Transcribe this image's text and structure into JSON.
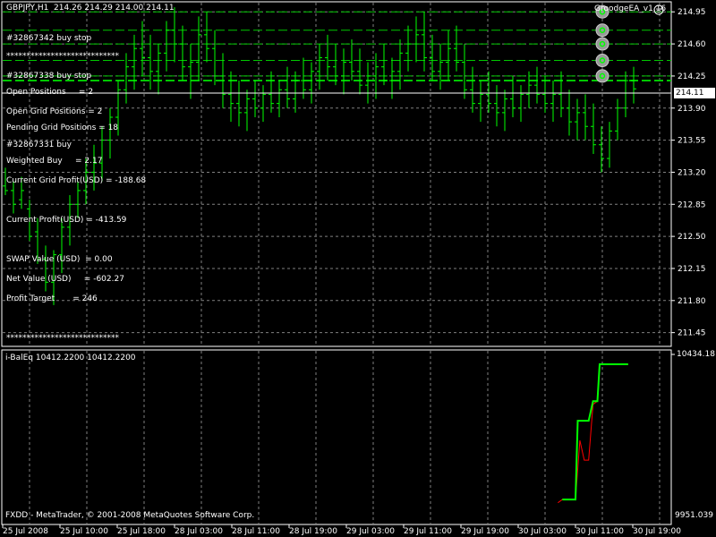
{
  "header": {
    "symbol_line": "GBPJPY,H1  214.26 214.29 214.00 214.11",
    "ea_name": "GroodgeEA_v1.16"
  },
  "info_panel": {
    "lines": [
      "#32867342 buy stop",
      "****************************",
      "#32867338 buy stop",
      "Open Positions     = 2",
      "Open Grid Positions = 2",
      "Pending Grid Positions = 18",
      "#32867331 buy",
      "Weighted Buy     = 2.17",
      "Current Grid Profit(USD) = -188.68",
      "",
      "Current Profit(USD) = -413.59",
      "",
      "SWAP Value (USD)  = 0.00",
      "Net Value (USD)     = -602.27",
      "Profit Target       = 246",
      "",
      "****************************"
    ]
  },
  "price_axis": {
    "labels": [
      "214.95",
      "214.60",
      "214.25",
      "213.90",
      "213.55",
      "213.20",
      "212.85",
      "212.50",
      "212.15",
      "211.80",
      "211.45"
    ],
    "current_price": "214.11"
  },
  "time_axis": {
    "labels": [
      "25 Jul 2008",
      "25 Jul 10:00",
      "25 Jul 18:00",
      "28 Jul 03:00",
      "28 Jul 11:00",
      "28 Jul 19:00",
      "29 Jul 03:00",
      "29 Jul 11:00",
      "29 Jul 19:00",
      "30 Jul 03:00",
      "30 Jul 11:00",
      "30 Jul 19:00"
    ]
  },
  "indicator": {
    "title": "i-BalEq 10412.2200 10412.2200",
    "axis_top": "10434.18",
    "axis_bottom": "9951.039"
  },
  "footer": {
    "copyright": "FXDD - MetaTrader, © 2001-2008 MetaQuotes Software Corp."
  },
  "colors": {
    "background": "#000000",
    "candle": "#00ff00",
    "grid": "#808080",
    "grid_levels": "#00c800",
    "balance_line": "#00ff00",
    "equity_line": "#ff0000"
  },
  "chart_data": {
    "type": "bar",
    "symbol": "GBPJPY",
    "timeframe": "H1",
    "ylim": [
      211.3,
      215.05
    ],
    "bars": [
      [
        213.05,
        213.25,
        212.95,
        213.0
      ],
      [
        213.0,
        213.1,
        212.75,
        212.85
      ],
      [
        212.9,
        213.15,
        212.8,
        213.0
      ],
      [
        212.8,
        212.9,
        212.45,
        212.5
      ],
      [
        212.55,
        212.7,
        212.2,
        212.25
      ],
      [
        212.25,
        212.4,
        211.9,
        212.0
      ],
      [
        212.0,
        212.35,
        211.75,
        212.3
      ],
      [
        212.3,
        212.7,
        212.1,
        212.6
      ],
      [
        212.6,
        212.95,
        212.4,
        212.85
      ],
      [
        212.85,
        213.1,
        212.7,
        213.0
      ],
      [
        213.0,
        213.35,
        212.85,
        213.2
      ],
      [
        213.2,
        213.5,
        213.0,
        213.3
      ],
      [
        213.3,
        213.7,
        213.1,
        213.55
      ],
      [
        213.55,
        213.9,
        213.35,
        213.8
      ],
      [
        213.8,
        214.2,
        213.6,
        214.1
      ],
      [
        214.1,
        214.5,
        213.95,
        214.35
      ],
      [
        214.35,
        214.7,
        214.1,
        214.55
      ],
      [
        214.55,
        214.85,
        214.25,
        214.45
      ],
      [
        214.45,
        214.7,
        214.1,
        214.3
      ],
      [
        214.3,
        214.6,
        214.05,
        214.5
      ],
      [
        214.5,
        214.85,
        214.3,
        214.75
      ],
      [
        214.75,
        215.0,
        214.4,
        214.6
      ],
      [
        214.6,
        214.8,
        214.2,
        214.35
      ],
      [
        214.35,
        214.6,
        214.0,
        214.4
      ],
      [
        214.4,
        214.9,
        214.2,
        214.7
      ],
      [
        214.7,
        214.95,
        214.4,
        214.55
      ],
      [
        214.55,
        214.75,
        214.15,
        214.25
      ],
      [
        214.25,
        214.5,
        213.9,
        214.05
      ],
      [
        214.05,
        214.3,
        213.75,
        213.95
      ],
      [
        213.95,
        214.2,
        213.7,
        213.85
      ],
      [
        213.85,
        214.1,
        213.65,
        214.0
      ],
      [
        214.0,
        214.2,
        213.8,
        213.9
      ],
      [
        213.9,
        214.15,
        213.75,
        214.05
      ],
      [
        214.05,
        214.3,
        213.85,
        213.95
      ],
      [
        213.95,
        214.2,
        213.8,
        214.1
      ],
      [
        214.1,
        214.35,
        213.9,
        214.0
      ],
      [
        214.0,
        214.3,
        213.85,
        214.2
      ],
      [
        214.2,
        214.45,
        214.0,
        214.1
      ],
      [
        214.1,
        214.4,
        213.95,
        214.3
      ],
      [
        214.3,
        214.6,
        214.1,
        214.45
      ],
      [
        214.45,
        214.7,
        214.2,
        214.35
      ],
      [
        214.35,
        214.6,
        214.15,
        214.25
      ],
      [
        214.25,
        214.55,
        214.05,
        214.4
      ],
      [
        214.4,
        214.65,
        214.2,
        214.3
      ],
      [
        214.3,
        214.55,
        214.05,
        214.15
      ],
      [
        214.15,
        214.4,
        213.95,
        214.25
      ],
      [
        214.25,
        214.5,
        214.0,
        214.35
      ],
      [
        214.35,
        214.6,
        214.15,
        214.2
      ],
      [
        214.2,
        214.45,
        214.0,
        214.3
      ],
      [
        214.3,
        214.65,
        214.1,
        214.5
      ],
      [
        214.5,
        214.8,
        214.3,
        214.6
      ],
      [
        214.6,
        214.9,
        214.4,
        214.7
      ],
      [
        214.7,
        214.95,
        214.3,
        214.45
      ],
      [
        214.45,
        214.7,
        214.2,
        214.3
      ],
      [
        214.3,
        214.6,
        214.1,
        214.4
      ],
      [
        214.4,
        214.75,
        214.2,
        214.55
      ],
      [
        214.55,
        214.8,
        214.3,
        214.4
      ],
      [
        214.4,
        214.6,
        214.0,
        214.1
      ],
      [
        214.1,
        214.35,
        213.85,
        213.95
      ],
      [
        213.95,
        214.2,
        213.75,
        214.05
      ],
      [
        214.05,
        214.3,
        213.85,
        213.95
      ],
      [
        213.95,
        214.15,
        213.7,
        213.85
      ],
      [
        213.85,
        214.1,
        213.65,
        214.0
      ],
      [
        214.0,
        214.25,
        213.8,
        213.9
      ],
      [
        213.9,
        214.15,
        213.75,
        214.05
      ],
      [
        214.05,
        214.3,
        213.9,
        214.15
      ],
      [
        214.15,
        214.35,
        213.95,
        214.05
      ],
      [
        214.05,
        214.25,
        213.85,
        213.95
      ],
      [
        213.95,
        214.2,
        213.75,
        214.05
      ],
      [
        214.05,
        214.3,
        213.8,
        213.9
      ],
      [
        213.9,
        214.1,
        213.6,
        213.75
      ],
      [
        213.75,
        214.0,
        213.55,
        213.85
      ],
      [
        213.85,
        214.05,
        213.55,
        213.7
      ],
      [
        213.7,
        213.95,
        213.4,
        213.5
      ],
      [
        213.5,
        213.7,
        213.2,
        213.35
      ],
      [
        213.35,
        213.75,
        213.25,
        213.65
      ],
      [
        213.65,
        214.0,
        213.55,
        213.9
      ],
      [
        213.9,
        214.3,
        213.8,
        214.2
      ],
      [
        214.2,
        214.35,
        213.95,
        214.11
      ]
    ],
    "grid_levels": [
      214.95,
      214.75,
      214.6,
      214.42,
      214.25
    ],
    "indicator": {
      "name": "i-BalEq",
      "ylim": [
        9951.039,
        10434.18
      ],
      "balance": [
        [
          127,
          10000
        ],
        [
          130,
          10000
        ],
        [
          130.5,
          10240
        ],
        [
          133,
          10240
        ],
        [
          134,
          10300
        ],
        [
          135,
          10300
        ],
        [
          135.5,
          10412.22
        ],
        [
          142,
          10412.22
        ]
      ],
      "equity": [
        [
          126,
          9990
        ],
        [
          127,
          10000
        ],
        [
          130,
          10000
        ],
        [
          131,
          10180
        ],
        [
          132,
          10120
        ],
        [
          133,
          10120
        ],
        [
          134,
          10290
        ],
        [
          135,
          10300
        ],
        [
          135.5,
          10412.22
        ],
        [
          142,
          10412.22
        ]
      ]
    }
  }
}
